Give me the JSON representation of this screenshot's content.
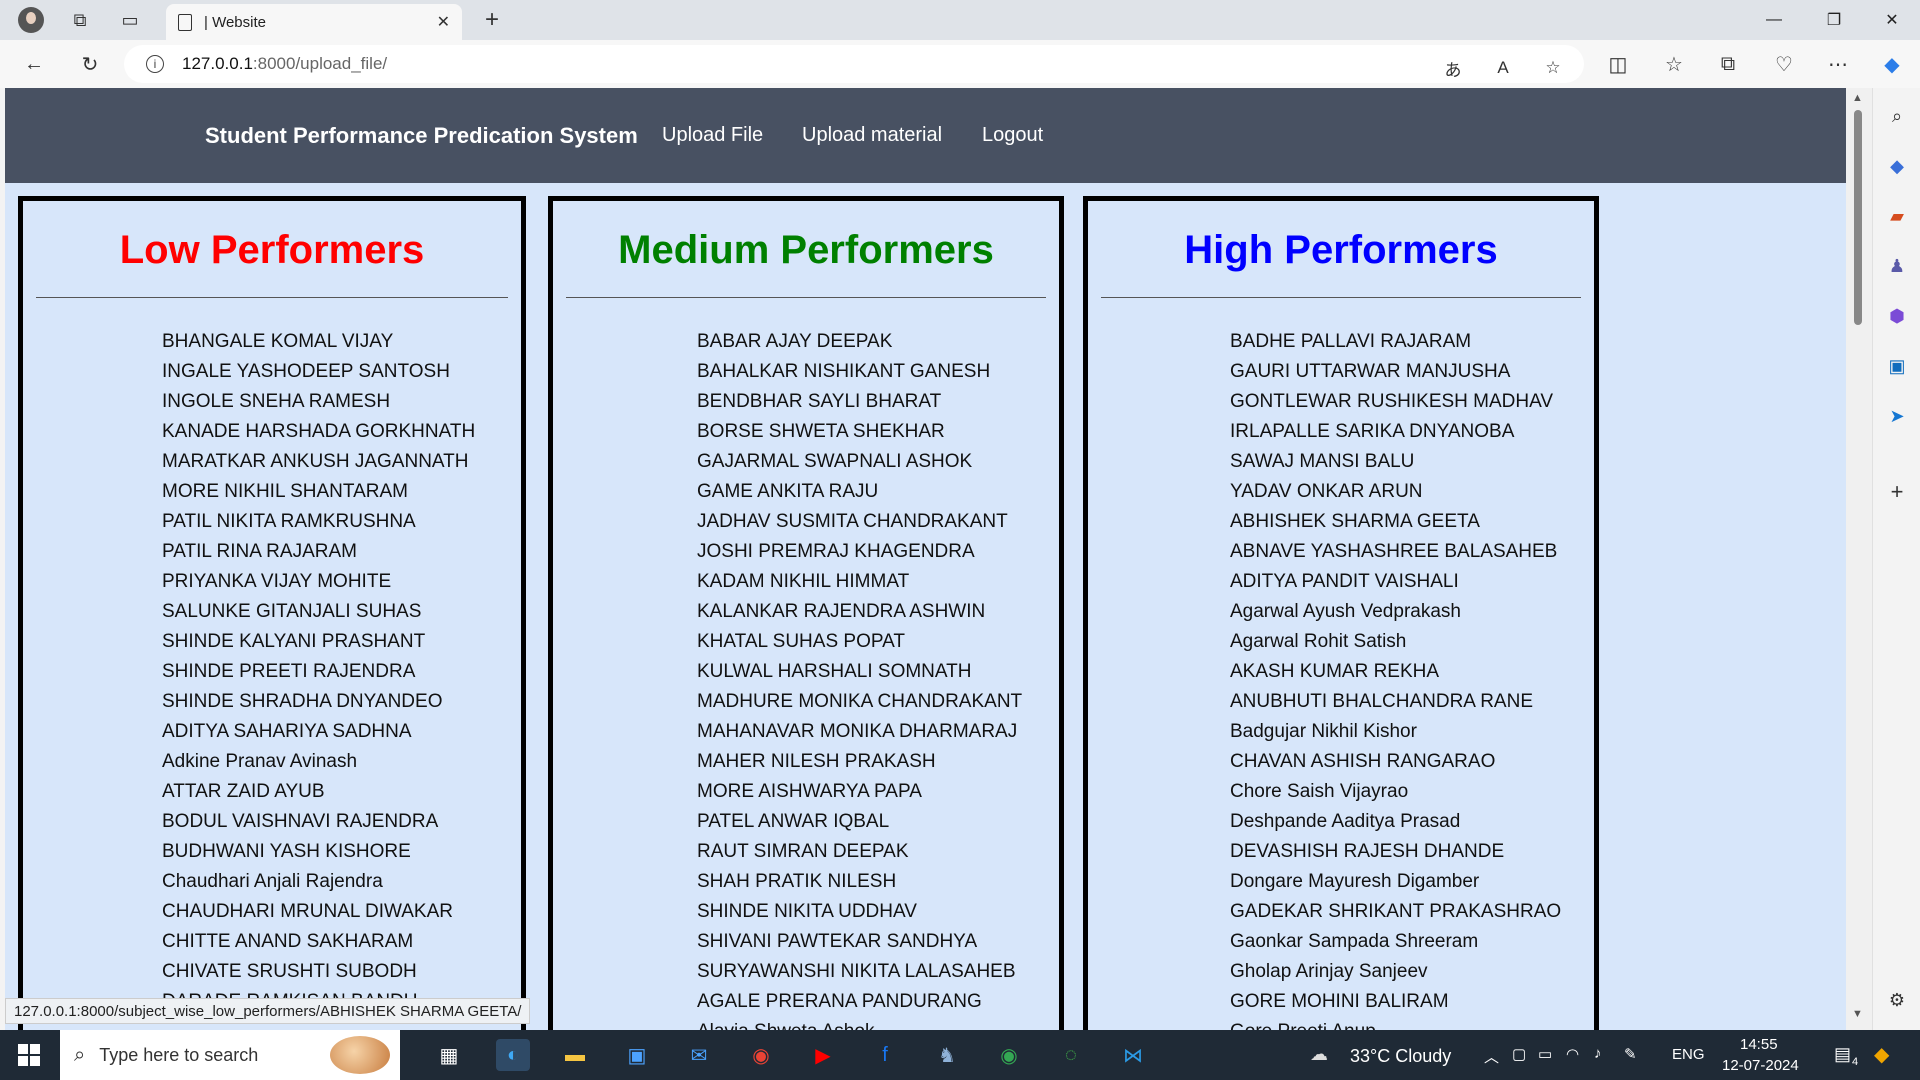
{
  "browser": {
    "tab_title": "| Website",
    "url_host": "127.0.0.1",
    "url_path": ":8000/upload_file/"
  },
  "site": {
    "brand": "Student Performance Predication System",
    "nav": [
      "Upload File",
      "Upload material",
      "Logout"
    ]
  },
  "columns": {
    "low": {
      "title": "Low Performers",
      "color": "#ff0000",
      "students": [
        "BHANGALE KOMAL VIJAY",
        "INGALE YASHODEEP SANTOSH",
        "INGOLE SNEHA RAMESH",
        "KANADE HARSHADA GORKHNATH",
        "MARATKAR ANKUSH JAGANNATH",
        "MORE NIKHIL SHANTARAM",
        "PATIL NIKITA RAMKRUSHNA",
        "PATIL RINA RAJARAM",
        "PRIYANKA VIJAY MOHITE",
        "SALUNKE GITANJALI SUHAS",
        "SHINDE KALYANI PRASHANT",
        "SHINDE PREETI RAJENDRA",
        "SHINDE SHRADHA DNYANDEO",
        "ADITYA SAHARIYA SADHNA",
        "Adkine Pranav Avinash",
        "ATTAR ZAID AYUB",
        "BODUL VAISHNAVI RAJENDRA",
        "BUDHWANI YASH KISHORE",
        "Chaudhari Anjali Rajendra",
        "CHAUDHARI MRUNAL DIWAKAR",
        "CHITTE ANAND SAKHARAM",
        "CHIVATE SRUSHTI SUBODH",
        "DARADE RAMKISAN BANDU"
      ]
    },
    "medium": {
      "title": "Medium Performers",
      "color": "#008000",
      "students": [
        "BABAR AJAY DEEPAK",
        "BAHALKAR NISHIKANT GANESH",
        "BENDBHAR SAYLI BHARAT",
        "BORSE SHWETA SHEKHAR",
        "GAJARMAL SWAPNALI ASHOK",
        "GAME ANKITA RAJU",
        "JADHAV SUSMITA CHANDRAKANT",
        "JOSHI PREMRAJ KHAGENDRA",
        "KADAM NIKHIL HIMMAT",
        "KALANKAR RAJENDRA ASHWIN",
        "KHATAL SUHAS POPAT",
        "KULWAL HARSHALI SOMNATH",
        "MADHURE MONIKA CHANDRAKANT",
        "MAHANAVAR MONIKA DHARMARAJ",
        "MAHER NILESH PRAKASH",
        "MORE AISHWARYA PAPA",
        "PATEL ANWAR IQBAL",
        "RAUT SIMRAN DEEPAK",
        "SHAH PRATIK NILESH",
        "SHINDE NIKITA UDDHAV",
        "SHIVANI PAWTEKAR SANDHYA",
        "SURYAWANSHI NIKITA LALASAHEB",
        "AGALE PRERANA PANDURANG",
        "Alavia Shweta Ashok"
      ]
    },
    "high": {
      "title": "High Performers",
      "color": "#0000ff",
      "students": [
        "BADHE PALLAVI RAJARAM",
        "GAURI UTTARWAR MANJUSHA",
        "GONTLEWAR RUSHIKESH MADHAV",
        "IRLAPALLE SARIKA DNYANOBA",
        "SAWAJ MANSI BALU",
        "YADAV ONKAR ARUN",
        "ABHISHEK SHARMA GEETA",
        "ABNAVE YASHASHREE BALASAHEB",
        "ADITYA PANDIT VAISHALI",
        "Agarwal Ayush Vedprakash",
        "Agarwal Rohit Satish",
        "AKASH KUMAR REKHA",
        "ANUBHUTI BHALCHANDRA RANE",
        "Badgujar Nikhil Kishor",
        "CHAVAN ASHISH RANGARAO",
        "Chore Saish Vijayrao",
        "Deshpande Aaditya Prasad",
        "DEVASHISH RAJESH DHANDE",
        "Dongare Mayuresh Digamber",
        "GADEKAR SHRIKANT PRAKASHRAO",
        "Gaonkar Sampada Shreeram",
        "Gholap Arinjay Sanjeev",
        "GORE MOHINI BALIRAM",
        "Gore Preeti Anup"
      ]
    }
  },
  "status_link": "127.0.0.1:8000/subject_wise_low_performers/ABHISHEK SHARMA GEETA/",
  "taskbar": {
    "search_placeholder": "Type here to search",
    "weather": "33°C  Cloudy",
    "language": "ENG",
    "time": "14:55",
    "date": "12-07-2024",
    "notification_count": "4"
  }
}
